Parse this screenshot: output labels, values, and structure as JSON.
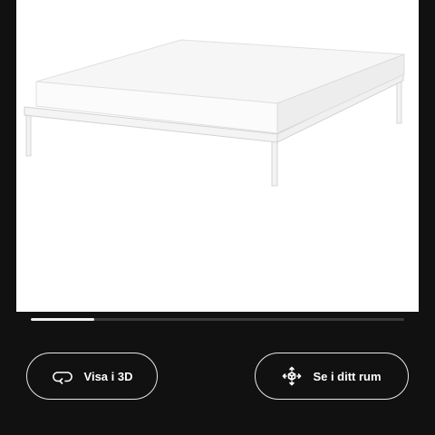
{
  "viewer": {
    "image_alt": "Vit sängstomme med madrass",
    "progress": 0.17
  },
  "actions": {
    "view_3d": {
      "label": "Visa i 3D",
      "icon": "rotate-3d-icon"
    },
    "view_ar": {
      "label": "Se i ditt rum",
      "icon": "ar-view-icon"
    }
  },
  "colors": {
    "background": "#111111",
    "photo_background": "#ffffff",
    "progress_track": "#3a3a3a",
    "progress_fill": "#f0f0f0",
    "button_border": "#e8e8e8",
    "button_text": "#ffffff"
  }
}
